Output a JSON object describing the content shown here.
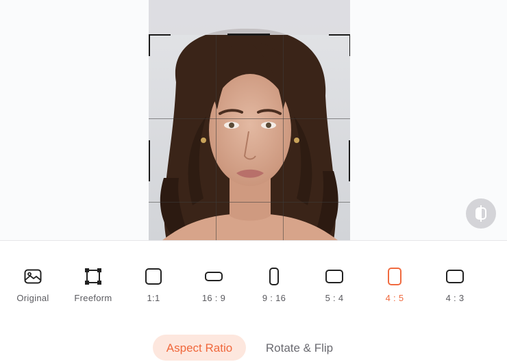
{
  "canvas": {
    "photo_alt": "Portrait of a woman with long curly dark hair"
  },
  "ratio_options": [
    {
      "label": "Original",
      "icon": "image-icon",
      "active": false
    },
    {
      "label": "Freeform",
      "icon": "freeform-crop-icon",
      "active": false
    },
    {
      "label": "1:1",
      "icon": "square-ratio-icon",
      "active": false
    },
    {
      "label": "16 : 9",
      "icon": "landscape-16-9-icon",
      "active": false
    },
    {
      "label": "9 : 16",
      "icon": "portrait-9-16-icon",
      "active": false
    },
    {
      "label": "5 : 4",
      "icon": "landscape-5-4-icon",
      "active": false
    },
    {
      "label": "4 : 5",
      "icon": "portrait-4-5-icon",
      "active": true
    },
    {
      "label": "4 : 3",
      "icon": "landscape-4-3-icon",
      "active": false
    }
  ],
  "tabs": {
    "aspect_ratio": "Aspect Ratio",
    "rotate_flip": "Rotate & Flip"
  },
  "colors": {
    "accent": "#f06a3f",
    "tab_active_bg": "#fde7de",
    "label": "#5a5a5f"
  }
}
